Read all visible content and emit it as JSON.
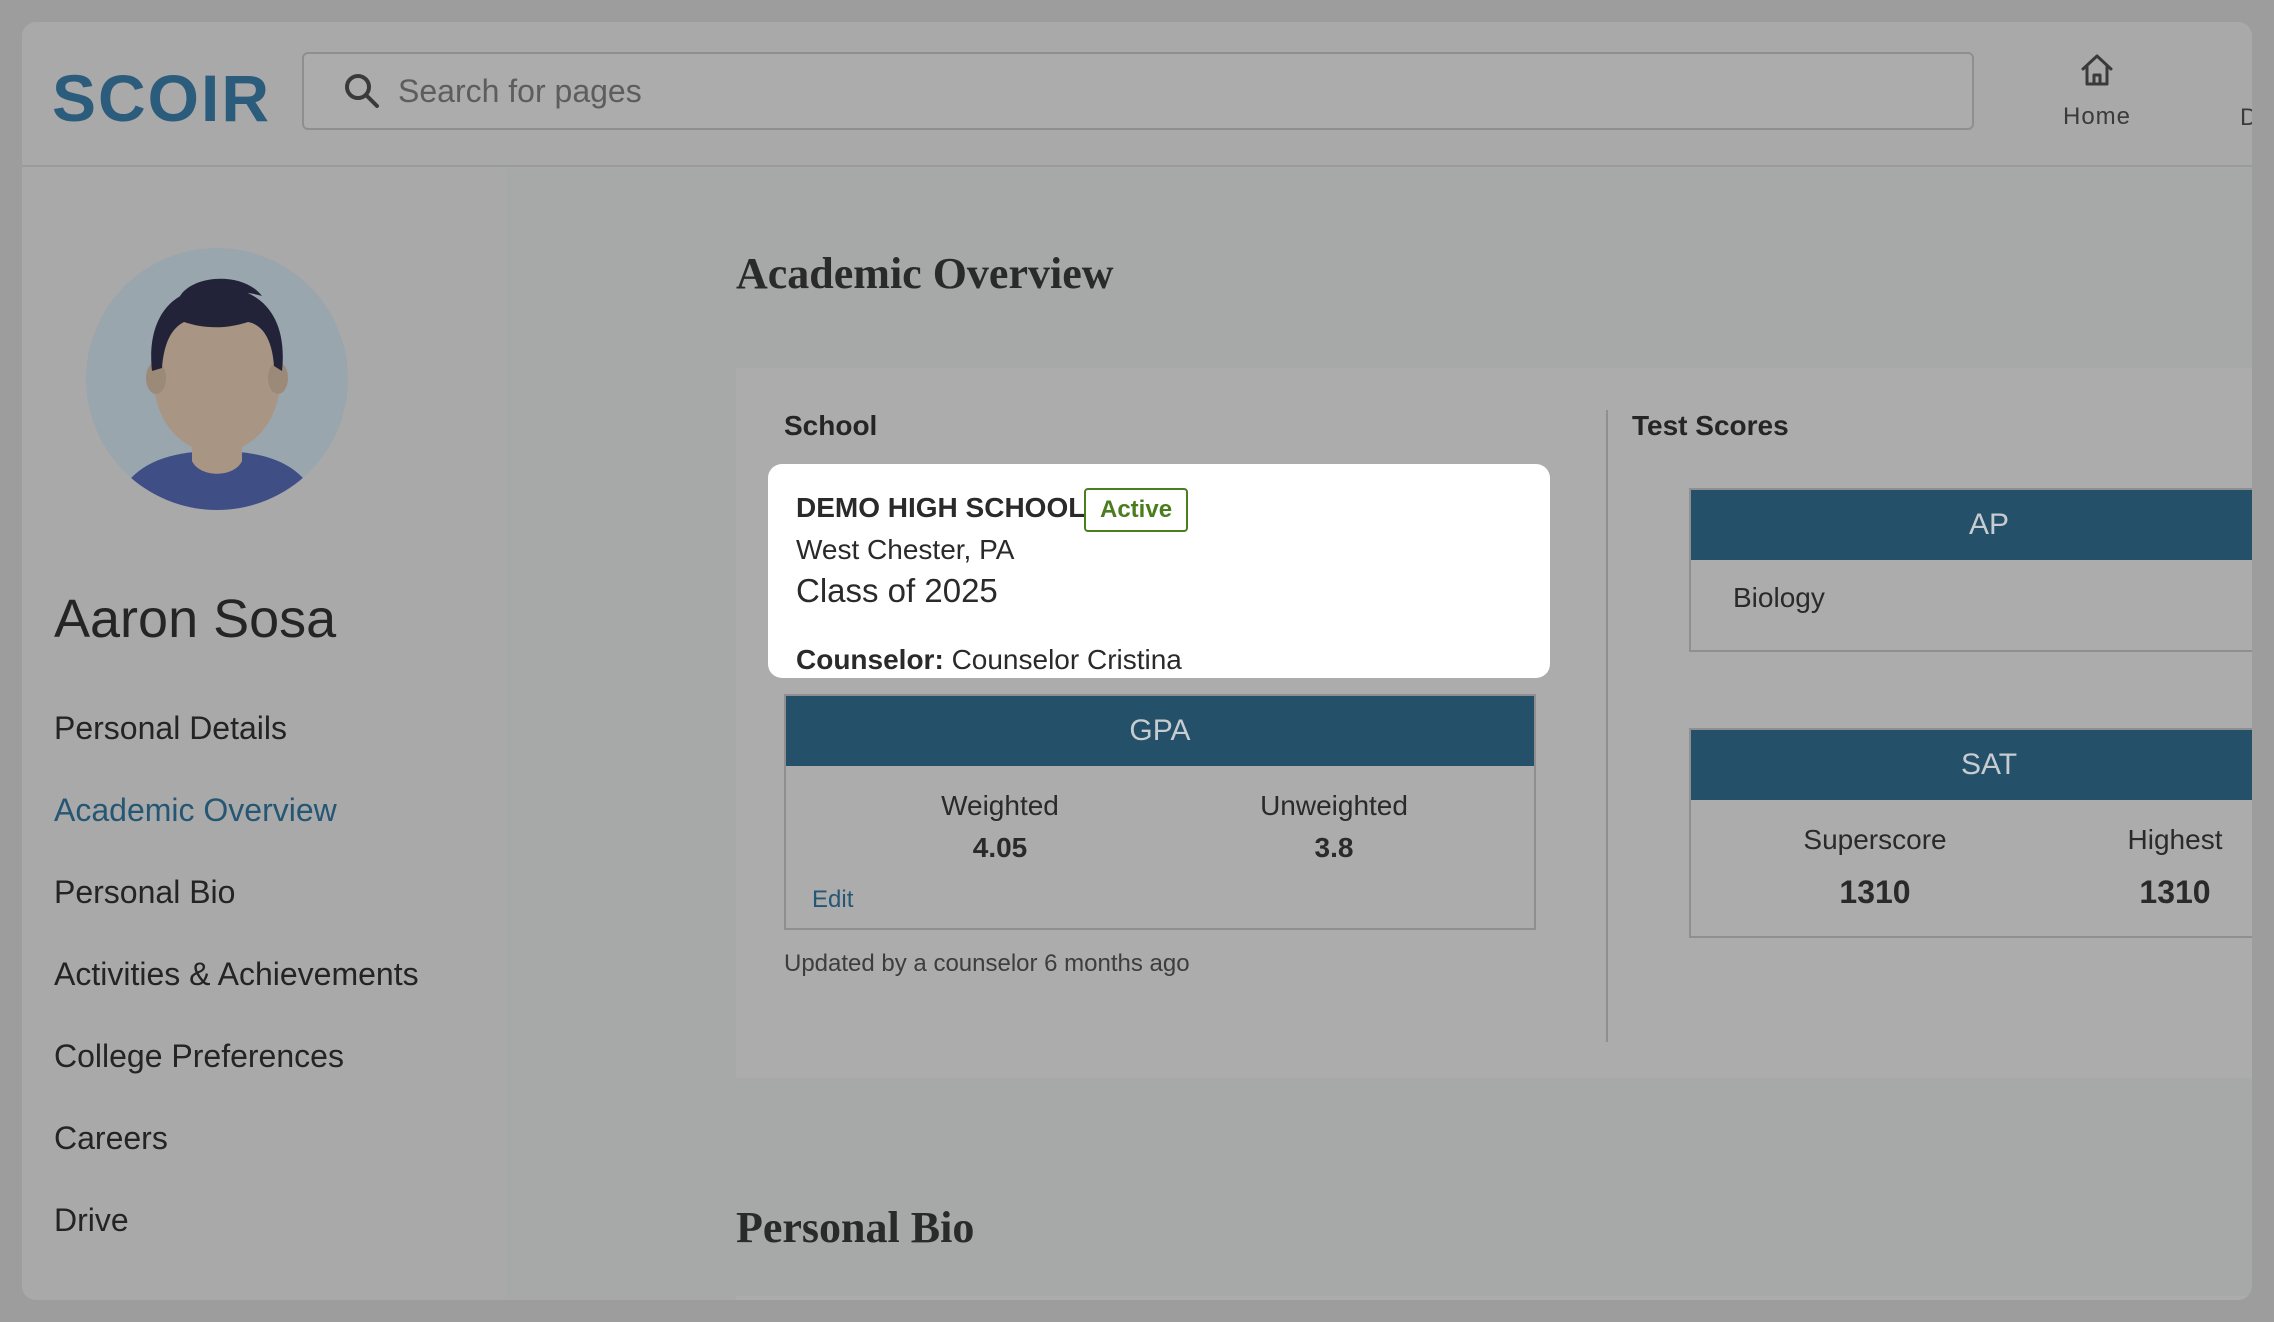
{
  "brand": {
    "logo_text": "SCOIR",
    "color": "#2c5c7c"
  },
  "search": {
    "placeholder": "Search for pages"
  },
  "top_nav": {
    "home_label": "Home",
    "clipped_label": "D"
  },
  "student": {
    "name": "Aaron Sosa"
  },
  "sidebar": {
    "items": [
      {
        "label": "Personal Details"
      },
      {
        "label": "Academic Overview"
      },
      {
        "label": "Personal Bio"
      },
      {
        "label": "Activities & Achievements"
      },
      {
        "label": "College Preferences"
      },
      {
        "label": "Careers"
      },
      {
        "label": "Drive"
      }
    ],
    "active_index": 1
  },
  "academic": {
    "title": "Academic Overview",
    "school_label": "School",
    "test_scores_label": "Test Scores",
    "school": {
      "name": "DEMO HIGH SCHOOL",
      "status": "Active",
      "location": "West Chester, PA",
      "class_of": "Class of 2025",
      "counselor_label": "Counselor:",
      "counselor_name": "Counselor Cristina"
    },
    "gpa": {
      "title": "GPA",
      "weighted_label": "Weighted",
      "weighted_value": "4.05",
      "unweighted_label": "Unweighted",
      "unweighted_value": "3.8",
      "edit_label": "Edit",
      "updated_note": "Updated by a counselor 6 months ago"
    },
    "ap": {
      "title": "AP",
      "subjects": [
        "Biology"
      ]
    },
    "sat": {
      "title": "SAT",
      "superscore_label": "Superscore",
      "superscore_value": "1310",
      "highest_label": "Highest",
      "highest_value": "1310"
    }
  },
  "personal_bio": {
    "title": "Personal Bio"
  },
  "colors": {
    "header_bar": "#245069",
    "active_link": "#255775",
    "badge_green": "#4b7d1f"
  }
}
